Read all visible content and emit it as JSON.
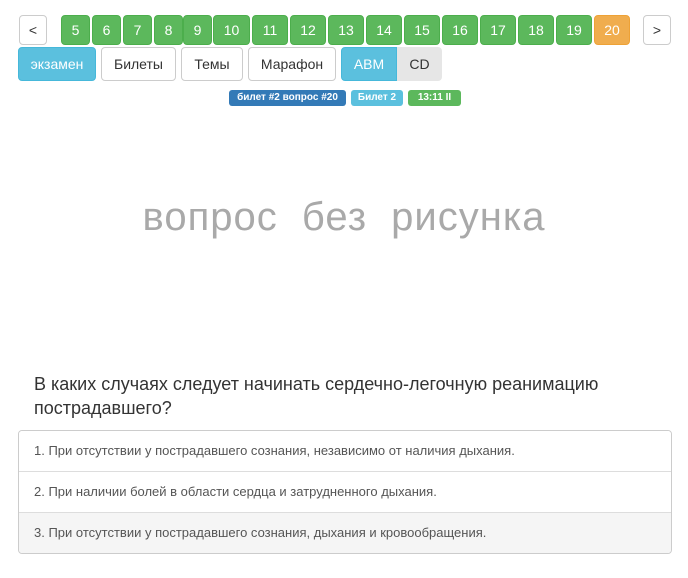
{
  "pager": {
    "prev_label": "<",
    "next_label": ">",
    "pages": [
      "5",
      "6",
      "7",
      "8",
      "9",
      "10",
      "11",
      "12",
      "13",
      "14",
      "15",
      "16",
      "17",
      "18",
      "19",
      "20"
    ],
    "current": "20"
  },
  "modes": {
    "exam": "экзамен",
    "tickets": "Билеты",
    "topics": "Темы",
    "marathon": "Марафон",
    "cat_abm": "ABM",
    "cat_cd": "CD"
  },
  "badges": {
    "ticket_question": "билет #2 вопрос #20",
    "ticket": "Билет 2",
    "timer": "13:11 II"
  },
  "no_image_text": "вопрос без рисунка",
  "question": "В каких случаях следует начинать сердечно-легочную реанимацию пострадавшего?",
  "answers": [
    "1. При отсутствии у пострадавшего сознания, независимо от наличия дыхания.",
    "2. При наличии болей в области сердца и затрудненного дыхания.",
    "3. При отсутствии у пострадавшего сознания, дыхания и кровообращения."
  ],
  "colors": {
    "green": "#5cb85c",
    "orange": "#f0ad4e",
    "info": "#5bc0de",
    "primary": "#337ab7"
  }
}
